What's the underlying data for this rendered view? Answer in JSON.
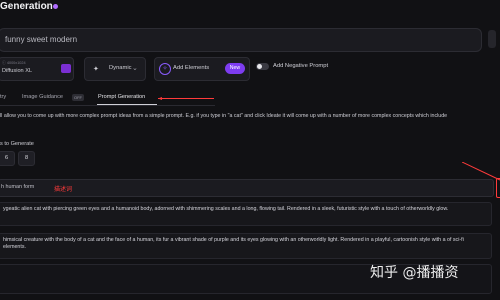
{
  "header": {
    "title": "Generation"
  },
  "prompt": {
    "value": "funny sweet modern"
  },
  "model": {
    "label_top": "ⓘ  4000x1024",
    "name": "Diffusion XL"
  },
  "style": {
    "icon": "magic-wand-icon",
    "label": "Dynamic",
    "chevron": "⌄"
  },
  "elements": {
    "label": "Add Elements",
    "badge": "New",
    "icon": "sparkle-icon"
  },
  "negative_prompt": {
    "label": "Add Negative Prompt",
    "enabled": false
  },
  "tabs": [
    {
      "label": "try"
    },
    {
      "label": "Image Guidance",
      "badge": "OFF"
    },
    {
      "label": "Prompt Generation",
      "active": true
    }
  ],
  "description": "ll allow you to come up with more complex prompt ideas from a simple prompt. E.g. if you type in \"a cat\" and click Ideate it will come up with a number of more complex concepts which include",
  "ideas": {
    "label": "s to Generate",
    "options": [
      "6",
      "8"
    ]
  },
  "idea_input": {
    "value": "h human form",
    "annotation": "描述词"
  },
  "outputs": [
    "ygeatic alien cat with piercing green eyes and a humanoid body, adorned with shimmering scales and a long, flowing tail. Rendered in a sleek, futuristic style with a touch of otherworldly glow.",
    "himsical creature with the body of a cat and the face of a human, its fur a vibrant shade of purple and its eyes glowing with an otherworldly light. Rendered in a playful, cartoonish style with a of sci-fi elements.",
    ""
  ],
  "watermark": "知乎 @播播资"
}
